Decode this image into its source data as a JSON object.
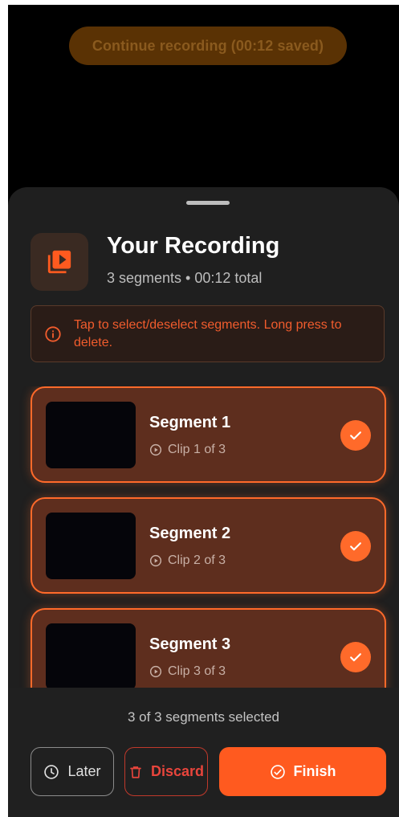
{
  "continue_pill": {
    "label": "Continue recording (00:12 saved)"
  },
  "header": {
    "title": "Your Recording",
    "subtitle": "3 segments • 00:12 total",
    "icon": "video-library-icon"
  },
  "info": {
    "icon": "info-icon",
    "text": "Tap to select/deselect segments. Long press to delete."
  },
  "segments": [
    {
      "title": "Segment 1",
      "clip": "Clip 1 of 3",
      "selected": true
    },
    {
      "title": "Segment 2",
      "clip": "Clip 2 of 3",
      "selected": true
    },
    {
      "title": "Segment 3",
      "clip": "Clip 3 of 3",
      "selected": true
    }
  ],
  "footer": {
    "selected_count": "3 of 3 segments selected",
    "later_label": "Later",
    "discard_label": "Discard",
    "finish_label": "Finish"
  },
  "colors": {
    "accent": "#ff5a1f",
    "sheet_background": "#1f1f1f",
    "discard": "#e8453c"
  }
}
